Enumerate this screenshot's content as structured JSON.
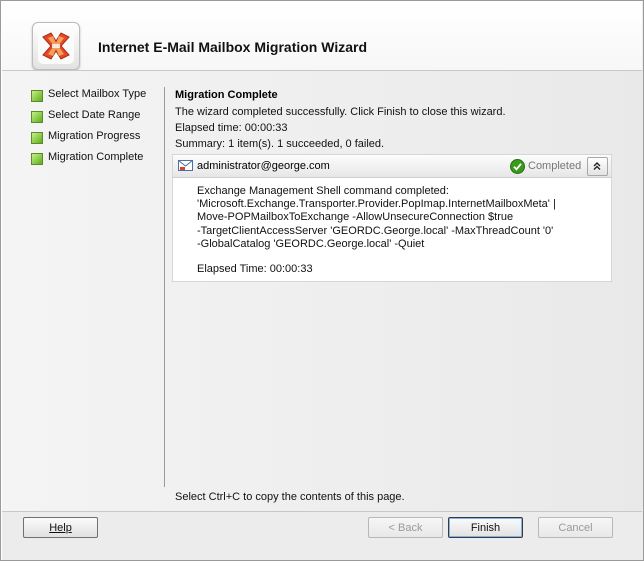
{
  "wizard": {
    "title": "Internet E-Mail Mailbox Migration Wizard"
  },
  "steps": [
    {
      "label": "Select Mailbox Type"
    },
    {
      "label": "Select Date Range"
    },
    {
      "label": "Migration Progress"
    },
    {
      "label": "Migration Complete"
    }
  ],
  "main": {
    "heading": "Migration Complete",
    "message": "The wizard completed successfully. Click Finish to close this wizard.",
    "elapsed": "Elapsed time: 00:00:33",
    "summary": "Summary: 1 item(s). 1 succeeded, 0 failed."
  },
  "result": {
    "email": "administrator@george.com",
    "status": "Completed",
    "message_lines": [
      "Exchange Management Shell command completed:",
      "'Microsoft.Exchange.Transporter.Provider.PopImap.InternetMailboxMeta' |",
      "Move-POPMailboxToExchange -AllowUnsecureConnection $true",
      "-TargetClientAccessServer 'GEORDC.George.local' -MaxThreadCount '0'",
      "-GlobalCatalog 'GEORDC.George.local' -Quiet"
    ],
    "elapsed": "Elapsed Time: 00:00:33"
  },
  "hint": "Select Ctrl+C to copy the contents of this page.",
  "buttons": {
    "help": "Help",
    "back": "< Back",
    "finish": "Finish",
    "cancel": "Cancel"
  },
  "colors": {
    "step_indicator": "#7cc832",
    "completed_check": "#3a9a1e"
  }
}
